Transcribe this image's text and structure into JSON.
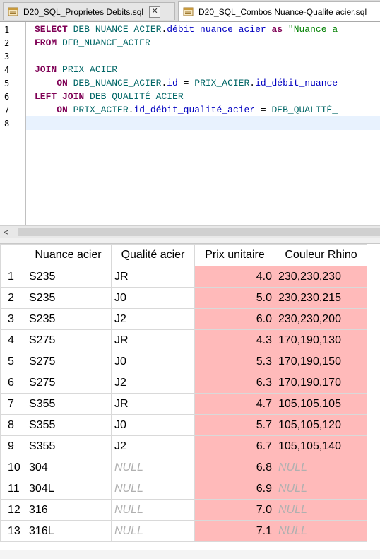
{
  "tabs": [
    {
      "label": "D20_SQL_Proprietes Debits.sql",
      "close": "✕"
    },
    {
      "label": "D20_SQL_Combos Nuance-Qualite acier.sql"
    }
  ],
  "editor": {
    "line_numbers": [
      "1",
      "2",
      "3",
      "4",
      "5",
      "6",
      "7",
      "8"
    ],
    "lines": [
      [
        {
          "t": "SELECT ",
          "c": "kw"
        },
        {
          "t": "DEB_NUANCE_ACIER",
          "c": "tbl"
        },
        {
          "t": ".",
          "c": ""
        },
        {
          "t": "débit_nuance_acier",
          "c": "col"
        },
        {
          "t": " as ",
          "c": "kw"
        },
        {
          "t": "\"Nuance a",
          "c": "str"
        }
      ],
      [
        {
          "t": "FROM ",
          "c": "kw"
        },
        {
          "t": "DEB_NUANCE_ACIER",
          "c": "tbl"
        }
      ],
      [],
      [
        {
          "t": "JOIN ",
          "c": "kw"
        },
        {
          "t": "PRIX_ACIER",
          "c": "tbl"
        }
      ],
      [
        {
          "t": "    ON ",
          "c": "kw"
        },
        {
          "t": "DEB_NUANCE_ACIER",
          "c": "tbl"
        },
        {
          "t": ".",
          "c": ""
        },
        {
          "t": "id",
          "c": "col"
        },
        {
          "t": " = ",
          "c": ""
        },
        {
          "t": "PRIX_ACIER",
          "c": "tbl"
        },
        {
          "t": ".",
          "c": ""
        },
        {
          "t": "id_débit_nuance",
          "c": "col"
        }
      ],
      [
        {
          "t": "LEFT JOIN ",
          "c": "kw"
        },
        {
          "t": "DEB_QUALITÉ_ACIER",
          "c": "tbl"
        }
      ],
      [
        {
          "t": "    ON ",
          "c": "kw"
        },
        {
          "t": "PRIX_ACIER",
          "c": "tbl"
        },
        {
          "t": ".",
          "c": ""
        },
        {
          "t": "id_débit_qualité_acier",
          "c": "col"
        },
        {
          "t": " = ",
          "c": ""
        },
        {
          "t": "DEB_QUALITÉ_",
          "c": "tbl"
        }
      ],
      []
    ]
  },
  "scrollbar": {
    "left_arrow": "<"
  },
  "results": {
    "columns": [
      "Nuance acier",
      "Qualité acier",
      "Prix unitaire",
      "Couleur Rhino"
    ],
    "rows": [
      [
        "1",
        "S235",
        "JR",
        "4.0",
        "230,230,230"
      ],
      [
        "2",
        "S235",
        "J0",
        "5.0",
        "230,230,215"
      ],
      [
        "3",
        "S235",
        "J2",
        "6.0",
        "230,230,200"
      ],
      [
        "4",
        "S275",
        "JR",
        "4.3",
        "170,190,130"
      ],
      [
        "5",
        "S275",
        "J0",
        "5.3",
        "170,190,150"
      ],
      [
        "6",
        "S275",
        "J2",
        "6.3",
        "170,190,170"
      ],
      [
        "7",
        "S355",
        "JR",
        "4.7",
        "105,105,105"
      ],
      [
        "8",
        "S355",
        "J0",
        "5.7",
        "105,105,120"
      ],
      [
        "9",
        "S355",
        "J2",
        "6.7",
        "105,105,140"
      ],
      [
        "10",
        "304",
        "NULL",
        "6.8",
        "NULL"
      ],
      [
        "11",
        "304L",
        "NULL",
        "6.9",
        "NULL"
      ],
      [
        "12",
        "316",
        "NULL",
        "7.0",
        "NULL"
      ],
      [
        "13",
        "316L",
        "NULL",
        "7.1",
        "NULL"
      ]
    ]
  },
  "colors": {
    "highlight_cells": "#ffbaba",
    "keyword": "#7f0055",
    "table_ident": "#006666",
    "column_ident": "#0000c0",
    "string": "#008000",
    "null_text": "#b0b0b0"
  }
}
